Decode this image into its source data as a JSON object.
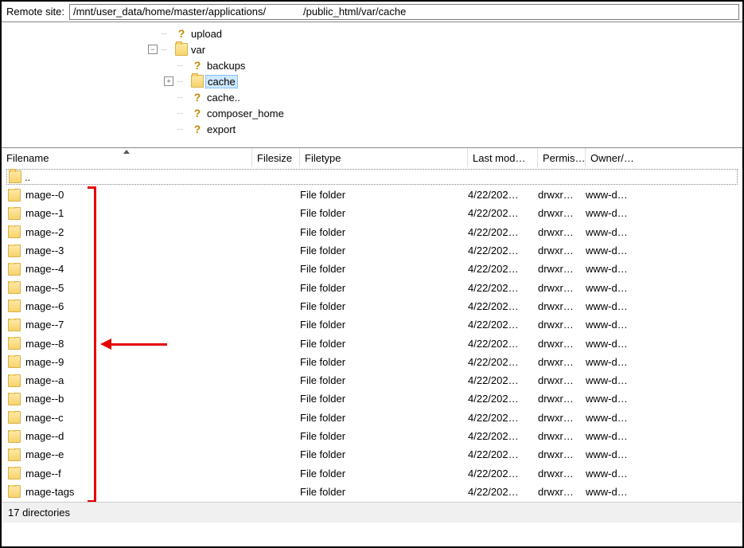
{
  "pathbar": {
    "label": "Remote site:",
    "value": "/mnt/user_data/home/master/applications/             /public_html/var/cache"
  },
  "tree": {
    "nodes": [
      {
        "indent": 0,
        "expander": "",
        "icon": "question",
        "label": "upload",
        "selected": false
      },
      {
        "indent": 0,
        "expander": "-",
        "icon": "folder",
        "label": "var",
        "selected": false
      },
      {
        "indent": 1,
        "expander": "",
        "icon": "question",
        "label": "backups",
        "selected": false
      },
      {
        "indent": 1,
        "expander": "+",
        "icon": "folder",
        "label": "cache",
        "selected": true
      },
      {
        "indent": 1,
        "expander": "",
        "icon": "question",
        "label": "cache..",
        "selected": false
      },
      {
        "indent": 1,
        "expander": "",
        "icon": "question",
        "label": "composer_home",
        "selected": false
      },
      {
        "indent": 1,
        "expander": "",
        "icon": "question",
        "label": "export",
        "selected": false
      }
    ]
  },
  "columns": {
    "filename": "Filename",
    "filesize": "Filesize",
    "filetype": "Filetype",
    "modified": "Last mod…",
    "permissions": "Permis…",
    "owner": "Owner/…"
  },
  "parent_row": "..",
  "files": [
    {
      "name": "mage--0",
      "type": "File folder",
      "modified": "4/22/202…",
      "perms": "drwxr…",
      "owner": "www-d…"
    },
    {
      "name": "mage--1",
      "type": "File folder",
      "modified": "4/22/202…",
      "perms": "drwxr…",
      "owner": "www-d…"
    },
    {
      "name": "mage--2",
      "type": "File folder",
      "modified": "4/22/202…",
      "perms": "drwxr…",
      "owner": "www-d…"
    },
    {
      "name": "mage--3",
      "type": "File folder",
      "modified": "4/22/202…",
      "perms": "drwxr…",
      "owner": "www-d…"
    },
    {
      "name": "mage--4",
      "type": "File folder",
      "modified": "4/22/202…",
      "perms": "drwxr…",
      "owner": "www-d…"
    },
    {
      "name": "mage--5",
      "type": "File folder",
      "modified": "4/22/202…",
      "perms": "drwxr…",
      "owner": "www-d…"
    },
    {
      "name": "mage--6",
      "type": "File folder",
      "modified": "4/22/202…",
      "perms": "drwxr…",
      "owner": "www-d…"
    },
    {
      "name": "mage--7",
      "type": "File folder",
      "modified": "4/22/202…",
      "perms": "drwxr…",
      "owner": "www-d…"
    },
    {
      "name": "mage--8",
      "type": "File folder",
      "modified": "4/22/202…",
      "perms": "drwxr…",
      "owner": "www-d…"
    },
    {
      "name": "mage--9",
      "type": "File folder",
      "modified": "4/22/202…",
      "perms": "drwxr…",
      "owner": "www-d…"
    },
    {
      "name": "mage--a",
      "type": "File folder",
      "modified": "4/22/202…",
      "perms": "drwxr…",
      "owner": "www-d…"
    },
    {
      "name": "mage--b",
      "type": "File folder",
      "modified": "4/22/202…",
      "perms": "drwxr…",
      "owner": "www-d…"
    },
    {
      "name": "mage--c",
      "type": "File folder",
      "modified": "4/22/202…",
      "perms": "drwxr…",
      "owner": "www-d…"
    },
    {
      "name": "mage--d",
      "type": "File folder",
      "modified": "4/22/202…",
      "perms": "drwxr…",
      "owner": "www-d…"
    },
    {
      "name": "mage--e",
      "type": "File folder",
      "modified": "4/22/202…",
      "perms": "drwxr…",
      "owner": "www-d…"
    },
    {
      "name": "mage--f",
      "type": "File folder",
      "modified": "4/22/202…",
      "perms": "drwxr…",
      "owner": "www-d…"
    },
    {
      "name": "mage-tags",
      "type": "File folder",
      "modified": "4/22/202…",
      "perms": "drwxr…",
      "owner": "www-d…"
    }
  ],
  "statusbar": {
    "text": "17 directories"
  }
}
